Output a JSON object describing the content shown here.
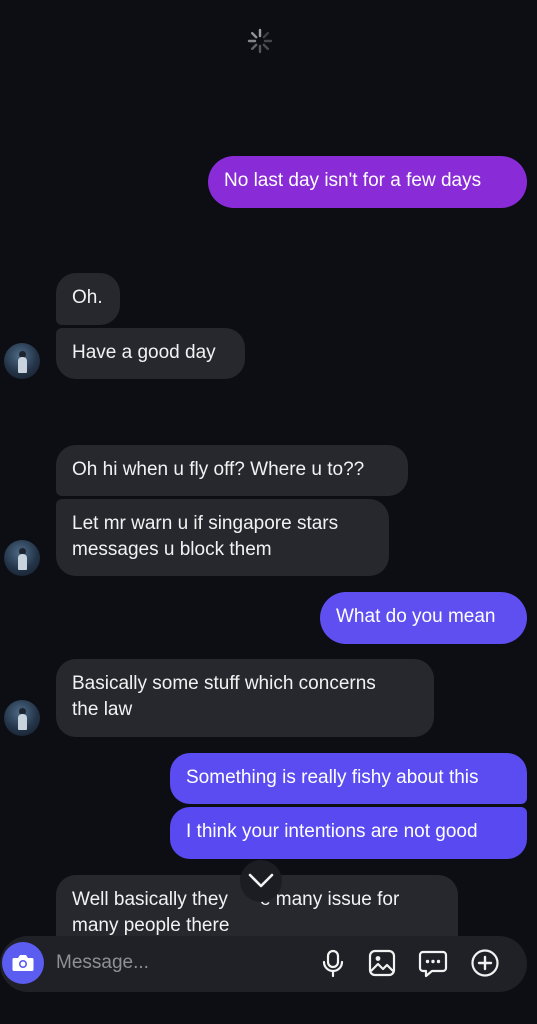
{
  "messages": {
    "m1": "No last day isn't for a few days",
    "m2": "Oh.",
    "m3": "Have a good day",
    "m4": "Oh hi when u fly off? Where u to??",
    "m5_l1": "Let mr warn u if singapore stars",
    "m5_l2": "messages u block them",
    "m6": "What do you mean",
    "m7_l1": "Basically some stuff which concerns",
    "m7_l2": "the law",
    "m8": "Something is really fishy about this",
    "m9": "I think your intentions are not good",
    "m10_l1a": "Well basically they",
    "m10_l1b": "e many issue for",
    "m10_l2": "many people there"
  },
  "composer": {
    "placeholder": "Message..."
  },
  "icons": {
    "loading": "loading-spinner-icon",
    "camera": "camera-icon",
    "mic": "microphone-icon",
    "gallery": "image-icon",
    "sticker": "sticker-icon",
    "plus": "plus-icon",
    "scroll": "chevron-down-icon"
  },
  "colors": {
    "background": "#0c0e13",
    "incoming_bubble": "#26282e",
    "outgoing_purple": "#8a2bd8",
    "outgoing_indigo": "#5b4cf0",
    "camera_button": "#5b5cf0"
  }
}
